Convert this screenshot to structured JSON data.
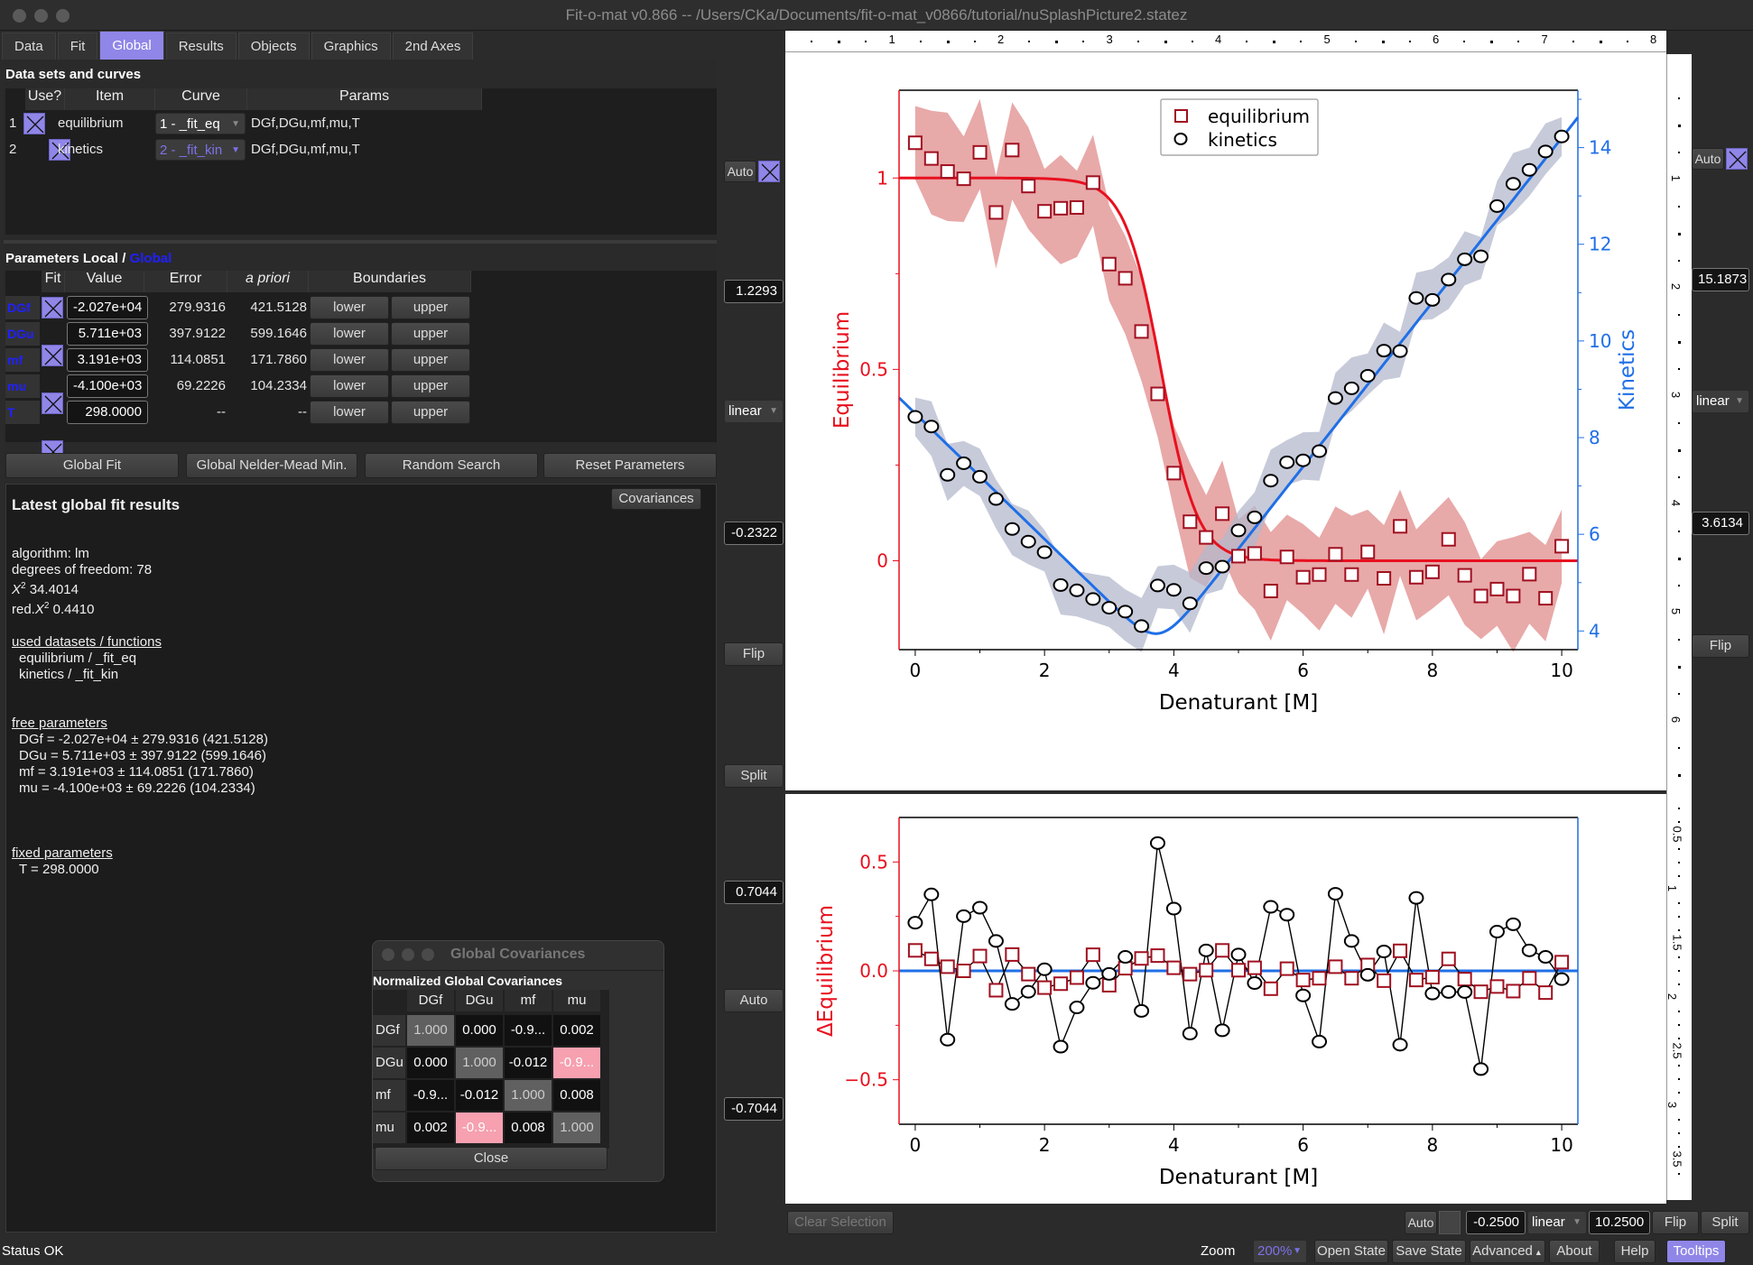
{
  "window": {
    "title": "Fit-o-mat v0.866 -- /Users/CKa/Documents/fit-o-mat_v0866/tutorial/nuSplashPicture2.statez"
  },
  "tabs": [
    {
      "label": "Data",
      "active": false
    },
    {
      "label": "Fit",
      "active": false
    },
    {
      "label": "Global",
      "active": true
    },
    {
      "label": "Results",
      "active": false
    },
    {
      "label": "Objects",
      "active": false
    },
    {
      "label": "Graphics",
      "active": false
    },
    {
      "label": "2nd Axes",
      "active": false
    }
  ],
  "datasets": {
    "title": "Data sets and curves",
    "columns": [
      "Use?",
      "Item",
      "Curve",
      "Params"
    ],
    "rows": [
      {
        "index": "1",
        "use": true,
        "item": "equilibrium",
        "curve": "1 - _fit_eq",
        "params": "DGf,DGu,mf,mu,T"
      },
      {
        "index": "2",
        "use": true,
        "item": "kinetics",
        "curve": "2 - _fit_kin",
        "params": "DGf,DGu,mf,mu,T"
      }
    ]
  },
  "parameters": {
    "title_local": "Parameters Local /",
    "title_global": "Global",
    "columns": [
      "Fit",
      "Value",
      "Error",
      "a priori",
      "Boundaries"
    ],
    "lower_label": "lower",
    "upper_label": "upper",
    "rows": [
      {
        "name": "DGf",
        "fit": true,
        "value": "-2.027e+04",
        "error": "279.9316",
        "apriori": "421.5128"
      },
      {
        "name": "DGu",
        "fit": true,
        "value": "5.711e+03",
        "error": "397.9122",
        "apriori": "599.1646"
      },
      {
        "name": "mf",
        "fit": true,
        "value": "3.191e+03",
        "error": "114.0851",
        "apriori": "171.7860"
      },
      {
        "name": "mu",
        "fit": true,
        "value": "-4.100e+03",
        "error": "69.2226",
        "apriori": "104.2334"
      },
      {
        "name": "T",
        "fit": false,
        "value": "298.0000",
        "error": "--",
        "apriori": "--"
      }
    ]
  },
  "actions": {
    "global_fit": "Global Fit",
    "nelder_mead": "Global Nelder-Mead Min.",
    "random_search": "Random Search",
    "reset": "Reset Parameters",
    "covariances": "Covariances"
  },
  "results": {
    "title": "Latest global fit results",
    "algorithm": "algorithm: lm",
    "dof": "degrees of freedom: 78",
    "chi2_label": "X",
    "chi2_value": " 34.4014",
    "redchi2_prefix": "red.",
    "redchi2_value": " 0.4410",
    "used_header": "used datasets / functions",
    "used": [
      "equilibrium / _fit_eq",
      "kinetics / _fit_kin"
    ],
    "free_header": "free parameters",
    "free": [
      "DGf = -2.027e+04 ± 279.9316 (421.5128)",
      "DGu = 5.711e+03 ± 397.9122 (599.1646)",
      "mf = 3.191e+03 ± 114.0851 (171.7860)",
      "mu = -4.100e+03 ± 69.2226 (104.2334)"
    ],
    "fixed_header": "fixed parameters",
    "fixed": [
      "T = 298.0000"
    ]
  },
  "covariance_dialog": {
    "title": "Global Covariances",
    "heading": "Normalized Global Covariances",
    "labels": [
      "DGf",
      "DGu",
      "mf",
      "mu"
    ],
    "matrix": [
      [
        "1.000",
        "0.000",
        "-0.9...",
        "0.002"
      ],
      [
        "0.000",
        "1.000",
        "-0.012",
        "-0.9..."
      ],
      [
        "-0.9...",
        "-0.012",
        "1.000",
        "0.008"
      ],
      [
        "0.002",
        "-0.9...",
        "0.008",
        "1.000"
      ]
    ],
    "highlight": [
      [
        1,
        3
      ],
      [
        3,
        1
      ]
    ],
    "close_label": "Close"
  },
  "left_axis_controls": {
    "auto_label": "Auto",
    "auto_checked": true,
    "max": "1.2293",
    "scale": "linear",
    "min": "-0.2322",
    "flip": "Flip",
    "split": "Split",
    "resid_max": "0.7044",
    "resid_auto": "Auto",
    "resid_min": "-0.7044"
  },
  "right_axis_controls": {
    "auto_label": "Auto",
    "auto_checked": true,
    "max": "15.1873",
    "scale": "linear",
    "min": "3.6134",
    "flip": "Flip"
  },
  "x_axis_controls": {
    "clear_selection": "Clear Selection",
    "auto_label": "Auto",
    "auto_checked": false,
    "min": "-0.2500",
    "scale": "linear",
    "max": "10.2500",
    "flip": "Flip",
    "split": "Split"
  },
  "bottom_bar": {
    "status": "Status OK",
    "zoom_label": "Zoom",
    "zoom_value": "200%",
    "open_state": "Open State",
    "save_state": "Save State",
    "advanced": "Advanced",
    "about": "About",
    "help": "Help",
    "tooltips": "Tooltips"
  },
  "rulers": {
    "top": [
      "1",
      "2",
      "3",
      "4",
      "5",
      "6",
      "7",
      "8"
    ],
    "right_upper": [
      "1",
      "2",
      "3",
      "4",
      "5",
      "6"
    ],
    "right_lower": [
      "0.5",
      "1",
      "1.5",
      "2",
      "2.5",
      "3",
      "3.5"
    ]
  },
  "colors": {
    "accent": "#8f86e8",
    "equilibrium": "#e8101e",
    "equilibrium_marker": "#a01020",
    "equilibrium_band": "#e08c8c",
    "kinetics": "#1f6fe6",
    "kinetics_band": "#b4b8cc",
    "param_name": "#2020ff"
  },
  "chart_data": [
    {
      "type": "scatter",
      "title": "",
      "xlabel": "Denaturant [M]",
      "ylabel": "Equilibrium",
      "y2label": "Kinetics",
      "xlim": [
        -0.25,
        10.25
      ],
      "ylim": [
        -0.2322,
        1.2293
      ],
      "y2lim": [
        3.6134,
        15.1873
      ],
      "xticks": [
        0,
        2,
        4,
        6,
        8,
        10
      ],
      "yticks": [
        0.0,
        0.5,
        1.0
      ],
      "y2ticks": [
        4,
        6,
        8,
        10,
        12,
        14
      ],
      "legend": {
        "position": "top-center",
        "entries": [
          "equilibrium",
          "kinetics"
        ]
      },
      "x": [
        0,
        0.25,
        0.5,
        0.75,
        1,
        1.25,
        1.5,
        1.75,
        2,
        2.25,
        2.5,
        2.75,
        3,
        3.25,
        3.5,
        3.75,
        4,
        4.25,
        4.5,
        4.75,
        5,
        5.25,
        5.5,
        5.75,
        6,
        6.25,
        6.5,
        6.75,
        7,
        7.25,
        7.5,
        7.75,
        8,
        8.25,
        8.5,
        8.75,
        9,
        9.25,
        9.5,
        9.75,
        10
      ],
      "series": [
        {
          "name": "equilibrium",
          "axis": "left",
          "marker": "square",
          "values": [
            1.092,
            1.051,
            1.017,
            0.998,
            1.067,
            0.91,
            1.073,
            0.979,
            0.913,
            0.921,
            0.923,
            0.988,
            0.775,
            0.738,
            0.599,
            0.436,
            0.229,
            0.102,
            0.061,
            0.123,
            0.012,
            0.019,
            -0.079,
            0.01,
            -0.043,
            -0.036,
            0.017,
            -0.036,
            0.023,
            -0.046,
            0.09,
            -0.043,
            -0.029,
            0.056,
            -0.038,
            -0.092,
            -0.074,
            -0.092,
            -0.035,
            -0.098,
            0.038
          ],
          "band_halfwidth": 0.12
        },
        {
          "name": "kinetics",
          "axis": "right",
          "marker": "circle",
          "values": [
            8.43,
            8.23,
            7.23,
            7.47,
            7.19,
            6.73,
            6.11,
            5.85,
            5.63,
            4.95,
            4.84,
            4.66,
            4.48,
            4.4,
            4.1,
            4.94,
            4.85,
            4.57,
            5.3,
            5.33,
            6.08,
            6.35,
            7.11,
            7.49,
            7.53,
            7.72,
            8.82,
            9.02,
            9.28,
            9.8,
            9.79,
            10.89,
            10.85,
            11.27,
            11.69,
            11.75,
            12.79,
            13.25,
            13.54,
            13.92,
            14.23
          ],
          "band_halfwidth": 0.5
        }
      ],
      "fits": [
        {
          "name": "equilibrium fit",
          "model": "sigmoid",
          "midpoint": 3.8,
          "width": 0.28,
          "top": 1.0,
          "bottom": 0.0
        },
        {
          "name": "kinetics fit",
          "model": "chevron",
          "left_intercept": 8.5,
          "left_slope": -1.3,
          "right_intercept": -2.8,
          "right_slope": 1.7
        }
      ]
    },
    {
      "type": "line",
      "title": "",
      "xlabel": "Denaturant [M]",
      "ylabel": "ΔEquilibrium",
      "xlim": [
        -0.25,
        10.25
      ],
      "ylim": [
        -0.7044,
        0.7044
      ],
      "xticks": [
        0,
        2,
        4,
        6,
        8,
        10
      ],
      "yticks": [
        -0.5,
        0.0,
        0.5
      ],
      "x": [
        0,
        0.25,
        0.5,
        0.75,
        1,
        1.25,
        1.5,
        1.75,
        2,
        2.25,
        2.5,
        2.75,
        3,
        3.25,
        3.5,
        3.75,
        4,
        4.25,
        4.5,
        4.75,
        5,
        5.25,
        5.5,
        5.75,
        6,
        6.25,
        6.5,
        6.75,
        7,
        7.25,
        7.5,
        7.75,
        8,
        8.25,
        8.5,
        8.75,
        9,
        9.25,
        9.5,
        9.75,
        10
      ],
      "series": [
        {
          "name": "equilibrium residuals",
          "marker": "square",
          "values": [
            0.094,
            0.055,
            0.019,
            0.0,
            0.068,
            -0.089,
            0.075,
            -0.015,
            -0.077,
            -0.059,
            -0.031,
            0.074,
            -0.066,
            0.012,
            0.057,
            0.07,
            0.014,
            -0.015,
            0.003,
            0.094,
            0.003,
            0.014,
            -0.082,
            0.01,
            -0.042,
            -0.034,
            0.019,
            -0.034,
            0.027,
            -0.045,
            0.092,
            -0.042,
            -0.029,
            0.055,
            -0.038,
            -0.096,
            -0.072,
            -0.093,
            -0.034,
            -0.1,
            0.04
          ]
        },
        {
          "name": "kinetics residuals",
          "marker": "circle",
          "values": [
            0.221,
            0.351,
            -0.316,
            0.251,
            0.29,
            0.137,
            -0.152,
            -0.096,
            0.007,
            -0.348,
            -0.168,
            -0.055,
            -0.014,
            0.064,
            -0.184,
            0.587,
            0.286,
            -0.288,
            0.094,
            -0.273,
            0.075,
            -0.056,
            0.294,
            0.258,
            -0.113,
            -0.325,
            0.354,
            0.137,
            -0.018,
            0.089,
            -0.339,
            0.335,
            -0.104,
            -0.097,
            -0.097,
            -0.451,
            0.18,
            0.214,
            0.094,
            0.064,
            -0.038
          ]
        }
      ],
      "zero_line": true
    }
  ]
}
